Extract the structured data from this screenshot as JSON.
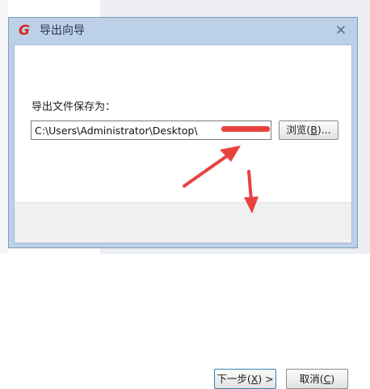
{
  "dialog": {
    "title": "导出向导",
    "close_glyph": "✕",
    "logo_glyph": "G",
    "save_label": "导出文件保存为：",
    "path_value": "C:\\Users\\Administrator\\Desktop\\",
    "browse_button": {
      "text": "浏览(",
      "key": "B",
      "suffix": ")..."
    },
    "next_button": {
      "text": "下一步(",
      "key": "X",
      "suffix": ") >"
    },
    "cancel_button": {
      "text": "取消(",
      "key": "C",
      "suffix": ")"
    }
  },
  "icons": [
    "app-logo-icon",
    "close-icon"
  ],
  "colors": {
    "title_bar": "#bcd0e8",
    "annotation": "#e8423f",
    "default_button_border": "#3c7fb1"
  }
}
